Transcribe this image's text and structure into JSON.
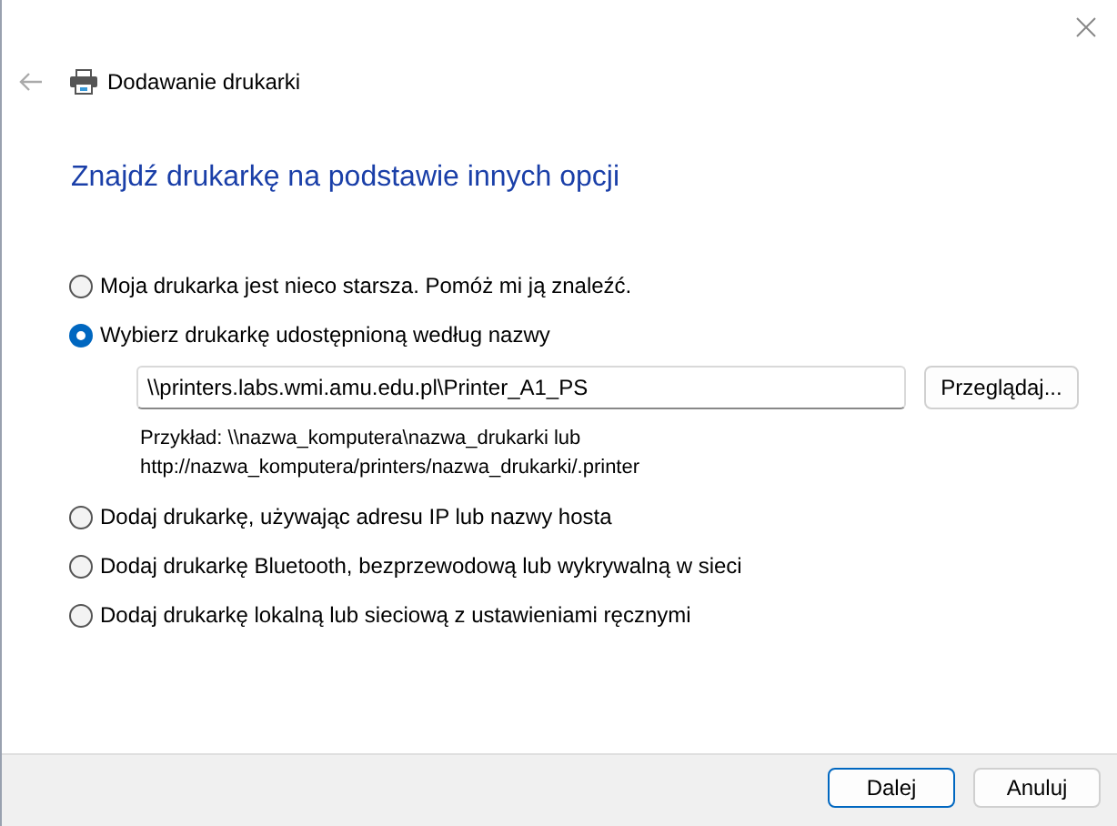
{
  "window": {
    "title": "Dodawanie drukarki"
  },
  "heading": "Znajdź drukarkę na podstawie innych opcji",
  "options": [
    {
      "label": "Moja drukarka jest nieco starsza. Pomóż mi ją znaleźć.",
      "selected": false
    },
    {
      "label": "Wybierz drukarkę udostępnioną według nazwy",
      "selected": true,
      "field": {
        "value": "\\\\printers.labs.wmi.amu.edu.pl\\Printer_A1_PS"
      },
      "browse_button": "Przeglądaj...",
      "hint_lines": [
        "Przykład: \\\\nazwa_komputera\\nazwa_drukarki lub",
        "http://nazwa_komputera/printers/nazwa_drukarki/.printer"
      ]
    },
    {
      "label": "Dodaj drukarkę, używając adresu IP lub nazwy hosta",
      "selected": false
    },
    {
      "label": "Dodaj drukarkę Bluetooth, bezprzewodową lub wykrywalną w sieci",
      "selected": false
    },
    {
      "label": "Dodaj drukarkę lokalną lub sieciową z ustawieniami ręcznymi",
      "selected": false
    }
  ],
  "buttons": [
    {
      "label": "Dalej",
      "kind": "default"
    },
    {
      "label": "Anuluj",
      "kind": "normal"
    }
  ]
}
